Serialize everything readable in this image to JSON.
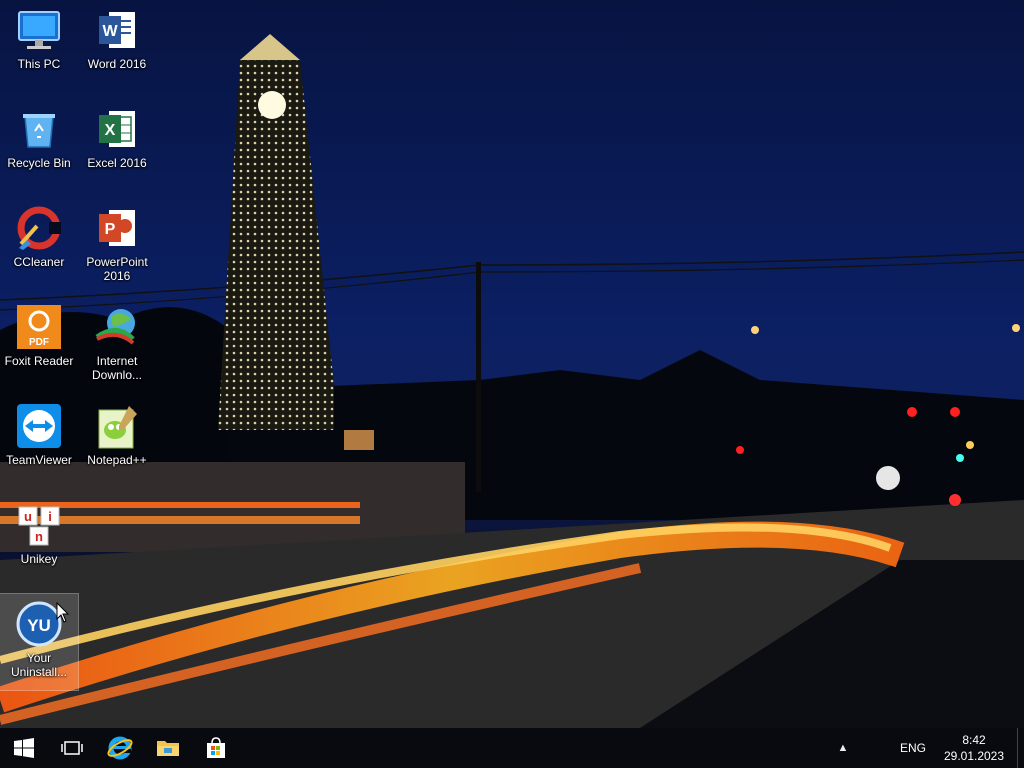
{
  "desktop": {
    "icons": [
      {
        "label": "This PC",
        "icon": "this-pc-icon"
      },
      {
        "label": "Word 2016",
        "icon": "word-icon"
      },
      {
        "label": "Recycle Bin",
        "icon": "recycle-bin-icon"
      },
      {
        "label": "Excel 2016",
        "icon": "excel-icon"
      },
      {
        "label": "CCleaner",
        "icon": "ccleaner-icon"
      },
      {
        "label": "PowerPoint 2016",
        "icon": "powerpoint-icon"
      },
      {
        "label": "Foxit Reader",
        "icon": "foxit-icon"
      },
      {
        "label": "Internet Downlo...",
        "icon": "idm-icon"
      },
      {
        "label": "TeamViewer",
        "icon": "teamviewer-icon"
      },
      {
        "label": "Notepad++",
        "icon": "notepadpp-icon"
      },
      {
        "label": "Unikey",
        "icon": "unikey-icon"
      },
      {
        "label": "Your Uninstall...",
        "icon": "your-uninstaller-icon"
      }
    ],
    "icon_text": {
      "word": "W",
      "excel": "X",
      "powerpoint": "P",
      "foxit": "PDF",
      "unikey": [
        "u",
        "i",
        "n"
      ],
      "your_uninstaller": "YU"
    }
  },
  "taskbar": {
    "pinned": [
      "start-icon",
      "task-view-icon",
      "internet-explorer-icon",
      "file-explorer-icon",
      "store-icon"
    ],
    "tray": {
      "chevron": "▲",
      "language": "ENG",
      "time": "8:42",
      "date": "29.01.2023"
    }
  },
  "colors": {
    "sky": "#0a1a5a",
    "tower_lights": "#ffe9a8",
    "light_trail": "#ff9a1f",
    "taskbar": "#0a0a0c"
  }
}
